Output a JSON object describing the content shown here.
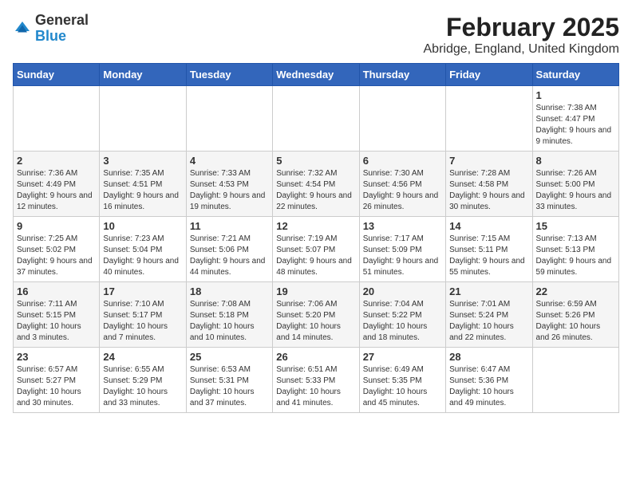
{
  "logo": {
    "general": "General",
    "blue": "Blue"
  },
  "title": "February 2025",
  "subtitle": "Abridge, England, United Kingdom",
  "weekdays": [
    "Sunday",
    "Monday",
    "Tuesday",
    "Wednesday",
    "Thursday",
    "Friday",
    "Saturday"
  ],
  "weeks": [
    [
      {
        "day": "",
        "info": ""
      },
      {
        "day": "",
        "info": ""
      },
      {
        "day": "",
        "info": ""
      },
      {
        "day": "",
        "info": ""
      },
      {
        "day": "",
        "info": ""
      },
      {
        "day": "",
        "info": ""
      },
      {
        "day": "1",
        "info": "Sunrise: 7:38 AM\nSunset: 4:47 PM\nDaylight: 9 hours\nand 9 minutes."
      }
    ],
    [
      {
        "day": "2",
        "info": "Sunrise: 7:36 AM\nSunset: 4:49 PM\nDaylight: 9 hours\nand 12 minutes."
      },
      {
        "day": "3",
        "info": "Sunrise: 7:35 AM\nSunset: 4:51 PM\nDaylight: 9 hours\nand 16 minutes."
      },
      {
        "day": "4",
        "info": "Sunrise: 7:33 AM\nSunset: 4:53 PM\nDaylight: 9 hours\nand 19 minutes."
      },
      {
        "day": "5",
        "info": "Sunrise: 7:32 AM\nSunset: 4:54 PM\nDaylight: 9 hours\nand 22 minutes."
      },
      {
        "day": "6",
        "info": "Sunrise: 7:30 AM\nSunset: 4:56 PM\nDaylight: 9 hours\nand 26 minutes."
      },
      {
        "day": "7",
        "info": "Sunrise: 7:28 AM\nSunset: 4:58 PM\nDaylight: 9 hours\nand 30 minutes."
      },
      {
        "day": "8",
        "info": "Sunrise: 7:26 AM\nSunset: 5:00 PM\nDaylight: 9 hours\nand 33 minutes."
      }
    ],
    [
      {
        "day": "9",
        "info": "Sunrise: 7:25 AM\nSunset: 5:02 PM\nDaylight: 9 hours\nand 37 minutes."
      },
      {
        "day": "10",
        "info": "Sunrise: 7:23 AM\nSunset: 5:04 PM\nDaylight: 9 hours\nand 40 minutes."
      },
      {
        "day": "11",
        "info": "Sunrise: 7:21 AM\nSunset: 5:06 PM\nDaylight: 9 hours\nand 44 minutes."
      },
      {
        "day": "12",
        "info": "Sunrise: 7:19 AM\nSunset: 5:07 PM\nDaylight: 9 hours\nand 48 minutes."
      },
      {
        "day": "13",
        "info": "Sunrise: 7:17 AM\nSunset: 5:09 PM\nDaylight: 9 hours\nand 51 minutes."
      },
      {
        "day": "14",
        "info": "Sunrise: 7:15 AM\nSunset: 5:11 PM\nDaylight: 9 hours\nand 55 minutes."
      },
      {
        "day": "15",
        "info": "Sunrise: 7:13 AM\nSunset: 5:13 PM\nDaylight: 9 hours\nand 59 minutes."
      }
    ],
    [
      {
        "day": "16",
        "info": "Sunrise: 7:11 AM\nSunset: 5:15 PM\nDaylight: 10 hours\nand 3 minutes."
      },
      {
        "day": "17",
        "info": "Sunrise: 7:10 AM\nSunset: 5:17 PM\nDaylight: 10 hours\nand 7 minutes."
      },
      {
        "day": "18",
        "info": "Sunrise: 7:08 AM\nSunset: 5:18 PM\nDaylight: 10 hours\nand 10 minutes."
      },
      {
        "day": "19",
        "info": "Sunrise: 7:06 AM\nSunset: 5:20 PM\nDaylight: 10 hours\nand 14 minutes."
      },
      {
        "day": "20",
        "info": "Sunrise: 7:04 AM\nSunset: 5:22 PM\nDaylight: 10 hours\nand 18 minutes."
      },
      {
        "day": "21",
        "info": "Sunrise: 7:01 AM\nSunset: 5:24 PM\nDaylight: 10 hours\nand 22 minutes."
      },
      {
        "day": "22",
        "info": "Sunrise: 6:59 AM\nSunset: 5:26 PM\nDaylight: 10 hours\nand 26 minutes."
      }
    ],
    [
      {
        "day": "23",
        "info": "Sunrise: 6:57 AM\nSunset: 5:27 PM\nDaylight: 10 hours\nand 30 minutes."
      },
      {
        "day": "24",
        "info": "Sunrise: 6:55 AM\nSunset: 5:29 PM\nDaylight: 10 hours\nand 33 minutes."
      },
      {
        "day": "25",
        "info": "Sunrise: 6:53 AM\nSunset: 5:31 PM\nDaylight: 10 hours\nand 37 minutes."
      },
      {
        "day": "26",
        "info": "Sunrise: 6:51 AM\nSunset: 5:33 PM\nDaylight: 10 hours\nand 41 minutes."
      },
      {
        "day": "27",
        "info": "Sunrise: 6:49 AM\nSunset: 5:35 PM\nDaylight: 10 hours\nand 45 minutes."
      },
      {
        "day": "28",
        "info": "Sunrise: 6:47 AM\nSunset: 5:36 PM\nDaylight: 10 hours\nand 49 minutes."
      },
      {
        "day": "",
        "info": ""
      }
    ]
  ]
}
